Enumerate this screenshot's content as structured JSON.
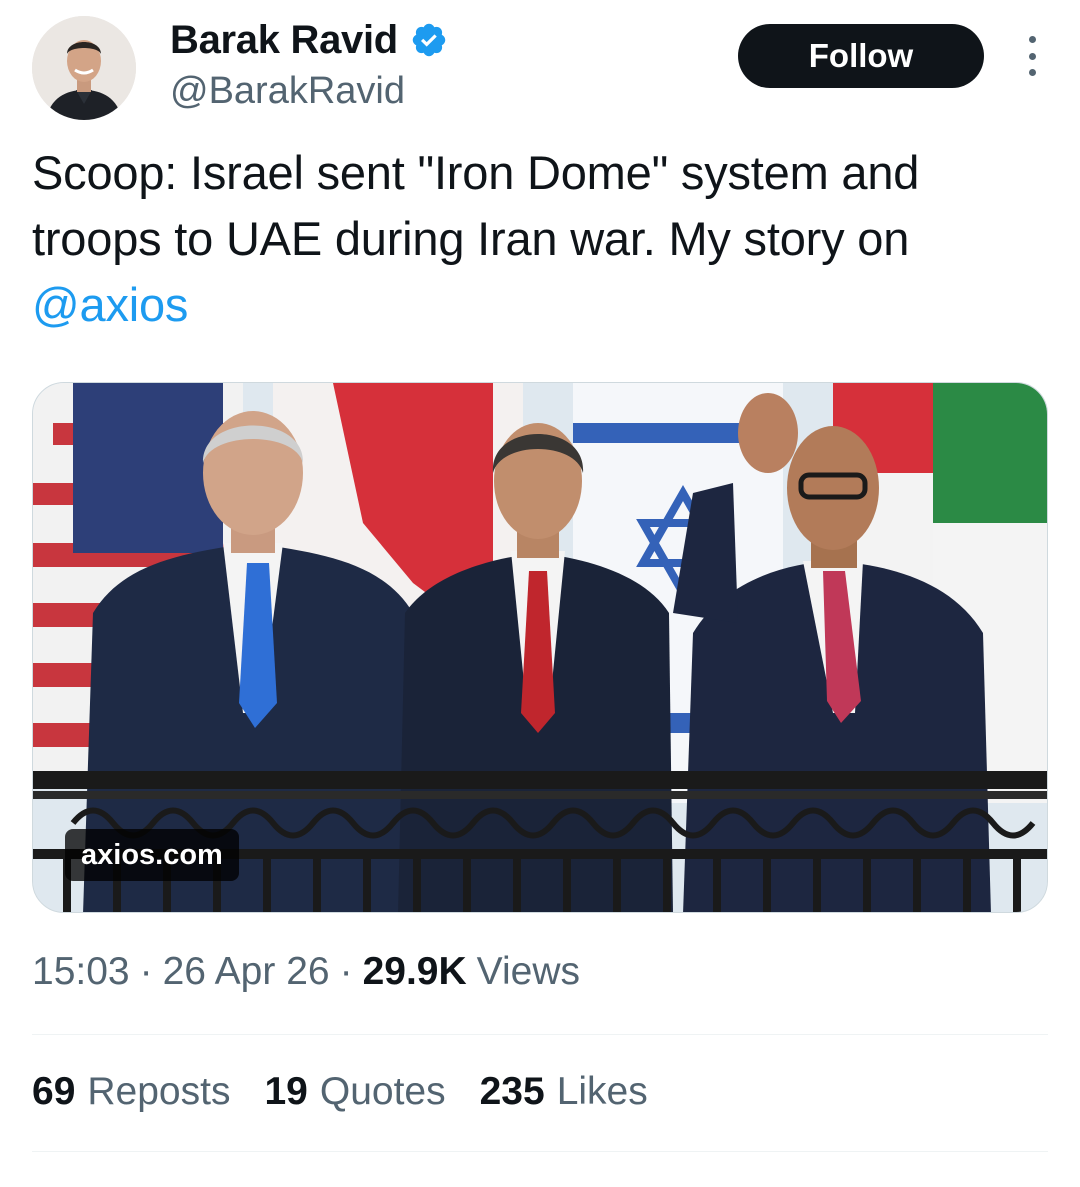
{
  "author": {
    "display_name": "Barak Ravid",
    "handle": "@BarakRavid",
    "verified": true
  },
  "follow_label": "Follow",
  "tweet": {
    "text": "Scoop: Israel sent \"Iron Dome\" system and troops to UAE during Iran war. My story on ",
    "mention": "@axios"
  },
  "link_card": {
    "domain": "axios.com"
  },
  "meta": {
    "time": "15:03",
    "separator": "·",
    "date": "26 Apr 26",
    "views_count": "29.9K",
    "views_label": "Views"
  },
  "stats": [
    {
      "count": "69",
      "label": "Reposts"
    },
    {
      "count": "19",
      "label": "Quotes"
    },
    {
      "count": "235",
      "label": "Likes"
    }
  ],
  "colors": {
    "accent": "#1d9bf0",
    "text_primary": "#0f1419",
    "text_secondary": "#536471",
    "follow_bg": "#0f1419"
  }
}
